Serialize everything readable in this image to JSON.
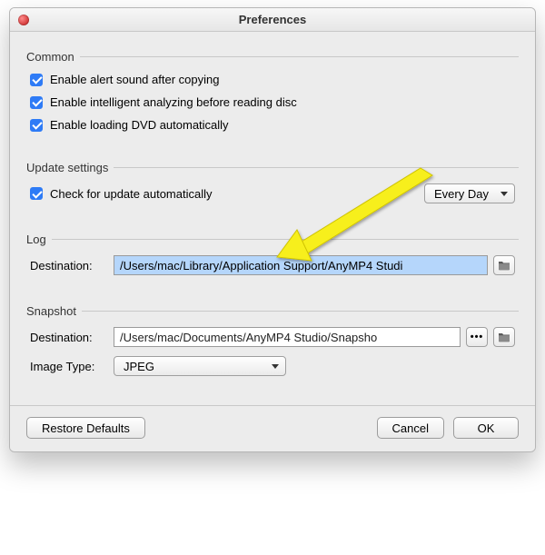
{
  "window": {
    "title": "Preferences"
  },
  "groups": {
    "common": {
      "title": "Common",
      "opt_alert": "Enable alert sound after copying",
      "opt_analyze": "Enable intelligent analyzing before reading disc",
      "opt_autoload": "Enable loading DVD automatically"
    },
    "update": {
      "title": "Update settings",
      "opt_check": "Check for update automatically",
      "interval_selected": "Every Day"
    },
    "log": {
      "title": "Log",
      "dest_label": "Destination:",
      "dest_value": "/Users/mac/Library/Application Support/AnyMP4 Studi"
    },
    "snapshot": {
      "title": "Snapshot",
      "dest_label": "Destination:",
      "dest_value": "/Users/mac/Documents/AnyMP4 Studio/Snapsho",
      "imgtype_label": "Image Type:",
      "imgtype_selected": "JPEG"
    }
  },
  "footer": {
    "restore": "Restore Defaults",
    "cancel": "Cancel",
    "ok": "OK"
  }
}
